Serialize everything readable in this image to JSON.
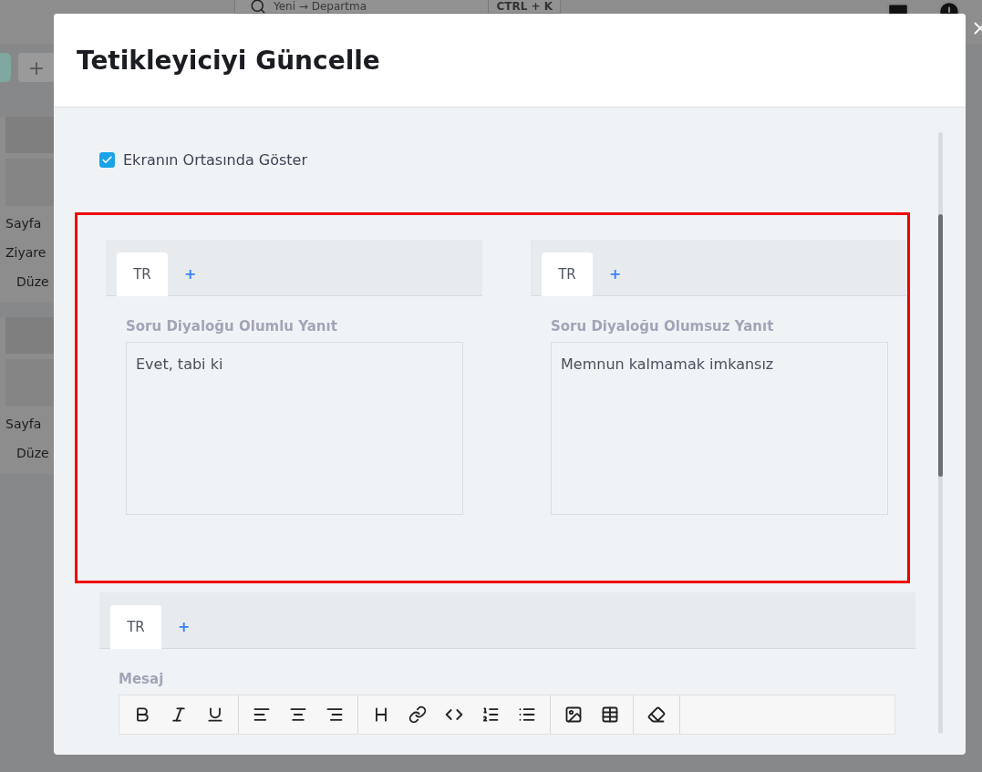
{
  "background": {
    "search_placeholder": "Yeni → Departma",
    "shortcut": "CTRL + K",
    "add_button": "+",
    "cards": [
      {
        "lines": [
          "Sayfa",
          "Ziyare",
          "Düze"
        ]
      },
      {
        "lines": [
          "Sayfa",
          "Düze"
        ]
      }
    ]
  },
  "dialog": {
    "title": "Tetikleyiciyi Güncelle",
    "show_center": {
      "label": "Ekranın Ortasında Göster",
      "checked": true
    },
    "answers": [
      {
        "tabs": [
          {
            "label": "TR",
            "selected": true
          }
        ],
        "add_tab": "+",
        "label": "Soru Diyaloğu Olumlu Yanıt",
        "value": "Evet, tabi ki"
      },
      {
        "tabs": [
          {
            "label": "TR",
            "selected": true
          }
        ],
        "add_tab": "+",
        "label": "Soru Diyaloğu Olumsuz Yanıt",
        "value": "Memnun kalmamak imkansız"
      }
    ],
    "message": {
      "tabs": [
        {
          "label": "TR",
          "selected": true
        }
      ],
      "add_tab": "+",
      "label": "Mesaj",
      "toolbar": [
        [
          {
            "kind": "bold"
          },
          {
            "kind": "italic"
          },
          {
            "kind": "underline"
          }
        ],
        [
          {
            "kind": "align-left"
          },
          {
            "kind": "align-center"
          },
          {
            "kind": "align-right"
          }
        ],
        [
          {
            "kind": "heading"
          },
          {
            "kind": "link"
          },
          {
            "kind": "code"
          },
          {
            "kind": "ordered-list"
          },
          {
            "kind": "bullet-list"
          }
        ],
        [
          {
            "kind": "image"
          },
          {
            "kind": "table"
          }
        ],
        [
          {
            "kind": "eraser"
          }
        ]
      ]
    }
  }
}
